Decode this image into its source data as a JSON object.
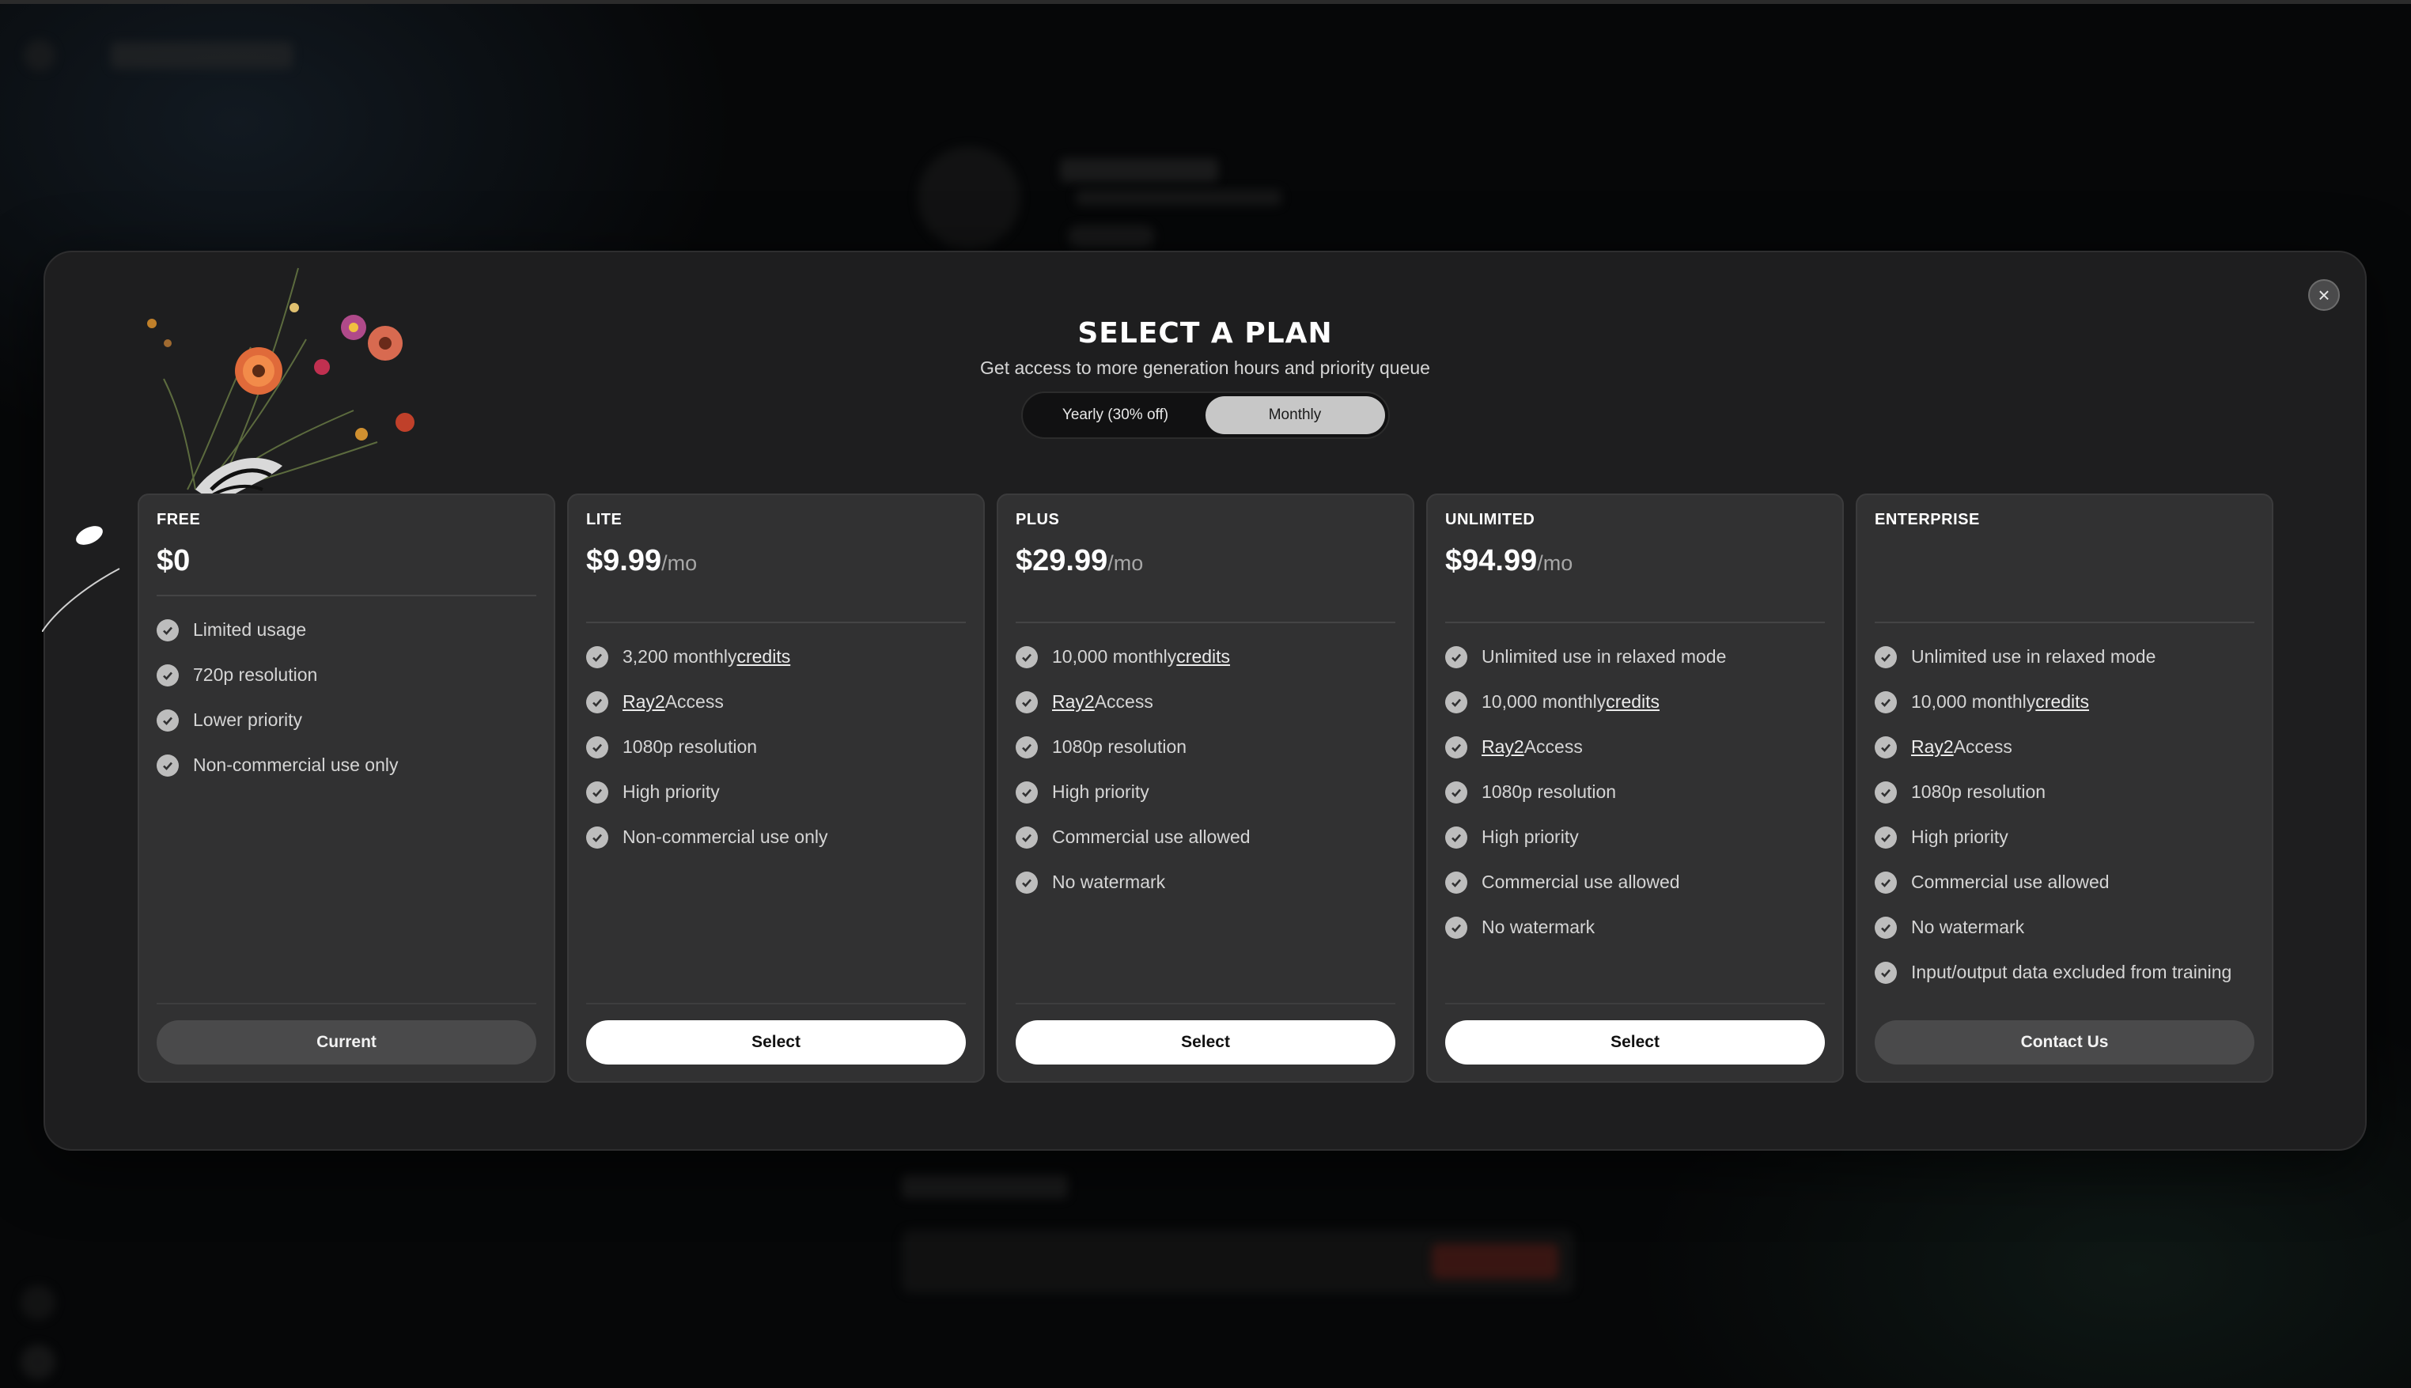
{
  "modal": {
    "title": "SELECT A PLAN",
    "subtitle": "Get access to more generation hours and priority queue",
    "close_icon": "close-icon",
    "toggle": {
      "options": [
        "Yearly (30% off)",
        "Monthly"
      ],
      "selected": "Monthly"
    }
  },
  "plans": [
    {
      "name": "FREE",
      "price": "$0",
      "period": "",
      "features": [
        {
          "text": "Limited usage"
        },
        {
          "text": "720p resolution"
        },
        {
          "text": "Lower priority"
        },
        {
          "text": "Non-commercial use only"
        }
      ],
      "button": "Current"
    },
    {
      "name": "LITE",
      "price": "$9.99",
      "period": "/mo",
      "features": [
        {
          "pre": "3,200 monthly ",
          "link": "credits",
          "post": ""
        },
        {
          "pre": "",
          "link": "Ray2",
          "post": " Access"
        },
        {
          "text": "1080p resolution"
        },
        {
          "text": "High priority"
        },
        {
          "text": "Non-commercial use only"
        }
      ],
      "button": "Select"
    },
    {
      "name": "PLUS",
      "price": "$29.99",
      "period": "/mo",
      "features": [
        {
          "pre": "10,000 monthly ",
          "link": "credits",
          "post": ""
        },
        {
          "pre": "",
          "link": "Ray2",
          "post": " Access"
        },
        {
          "text": "1080p resolution"
        },
        {
          "text": "High priority"
        },
        {
          "text": "Commercial use allowed"
        },
        {
          "text": "No watermark"
        }
      ],
      "button": "Select"
    },
    {
      "name": "UNLIMITED",
      "price": "$94.99",
      "period": "/mo",
      "features": [
        {
          "text": "Unlimited use in relaxed mode"
        },
        {
          "pre": "10,000 monthly ",
          "link": "credits",
          "post": ""
        },
        {
          "pre": "",
          "link": "Ray2",
          "post": " Access"
        },
        {
          "text": "1080p resolution"
        },
        {
          "text": "High priority"
        },
        {
          "text": "Commercial use allowed"
        },
        {
          "text": "No watermark"
        }
      ],
      "button": "Select"
    },
    {
      "name": "ENTERPRISE",
      "price": "",
      "period": "",
      "features": [
        {
          "text": "Unlimited use in relaxed mode"
        },
        {
          "pre": "10,000 monthly ",
          "link": "credits",
          "post": ""
        },
        {
          "pre": "",
          "link": "Ray2",
          "post": " Access"
        },
        {
          "text": "1080p resolution"
        },
        {
          "text": "High priority"
        },
        {
          "text": "Commercial use allowed"
        },
        {
          "text": "No watermark"
        },
        {
          "text": "Input/output data excluded from training"
        }
      ],
      "button": "Contact Us"
    }
  ],
  "colors": {
    "modal_bg": "#1e1e1f",
    "card_bg": "#313132",
    "accent_button": "#ffffff",
    "check": "#bdbdbd"
  }
}
